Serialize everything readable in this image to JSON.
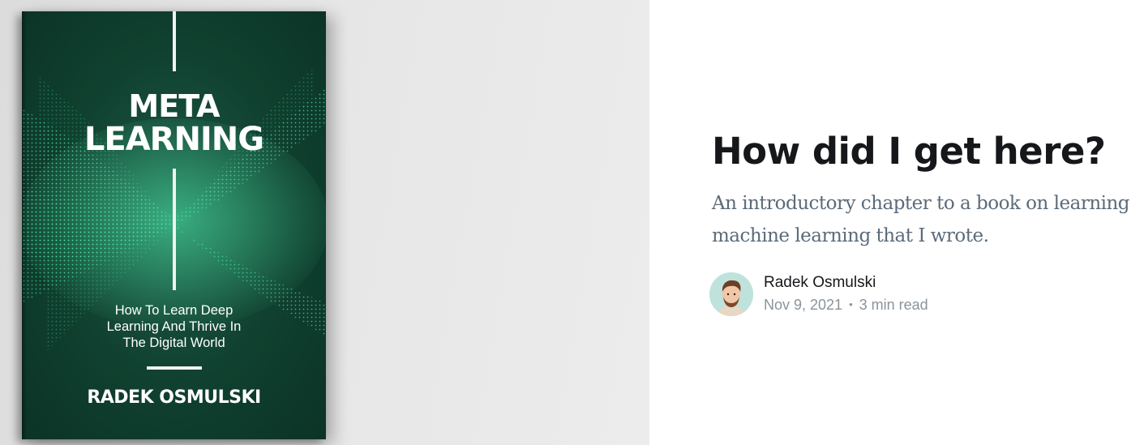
{
  "hero": {
    "book_cover": {
      "title_line1": "META",
      "title_line2": "LEARNING",
      "subtitle_line1": "How To Learn Deep",
      "subtitle_line2": "Learning And Thrive In",
      "subtitle_line3": "The Digital World",
      "author": "RADEK OSMULSKI",
      "cover_color": "#10402f",
      "accent_color": "#3fcf9a"
    }
  },
  "post": {
    "title": "How did I get here?",
    "excerpt": "An introductory chapter to a book on learning machine learning that I wrote.",
    "author": {
      "name": "Radek Osmulski",
      "avatar_icon": "avatar-illustration"
    },
    "date": "Nov 9, 2021",
    "separator": "•",
    "reading_time": "3 min read"
  }
}
